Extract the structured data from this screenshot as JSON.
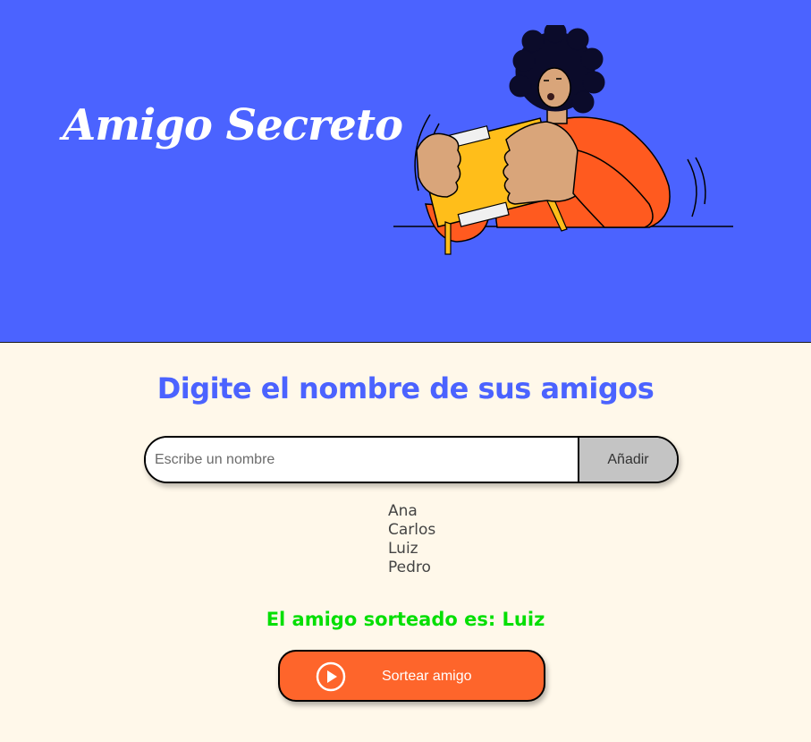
{
  "header": {
    "title": "Amigo Secreto",
    "illustration_icon": "person-holding-gift-box-illustration",
    "background_color": "#4B63FF"
  },
  "main": {
    "heading": "Digite el nombre de sus amigos",
    "input": {
      "placeholder": "Escribe un nombre",
      "value": ""
    },
    "add_button_label": "Añadir",
    "friends": [
      "Ana",
      "Carlos",
      "Luiz",
      "Pedro"
    ],
    "result": "El amigo sorteado es: Luiz",
    "draw_button": {
      "label": "Sortear amigo",
      "icon": "play-circle-icon"
    },
    "colors": {
      "accent": "#4B63FF",
      "result": "#05DF05",
      "draw_button": "#FE652B",
      "background": "#FFF8EA"
    }
  }
}
